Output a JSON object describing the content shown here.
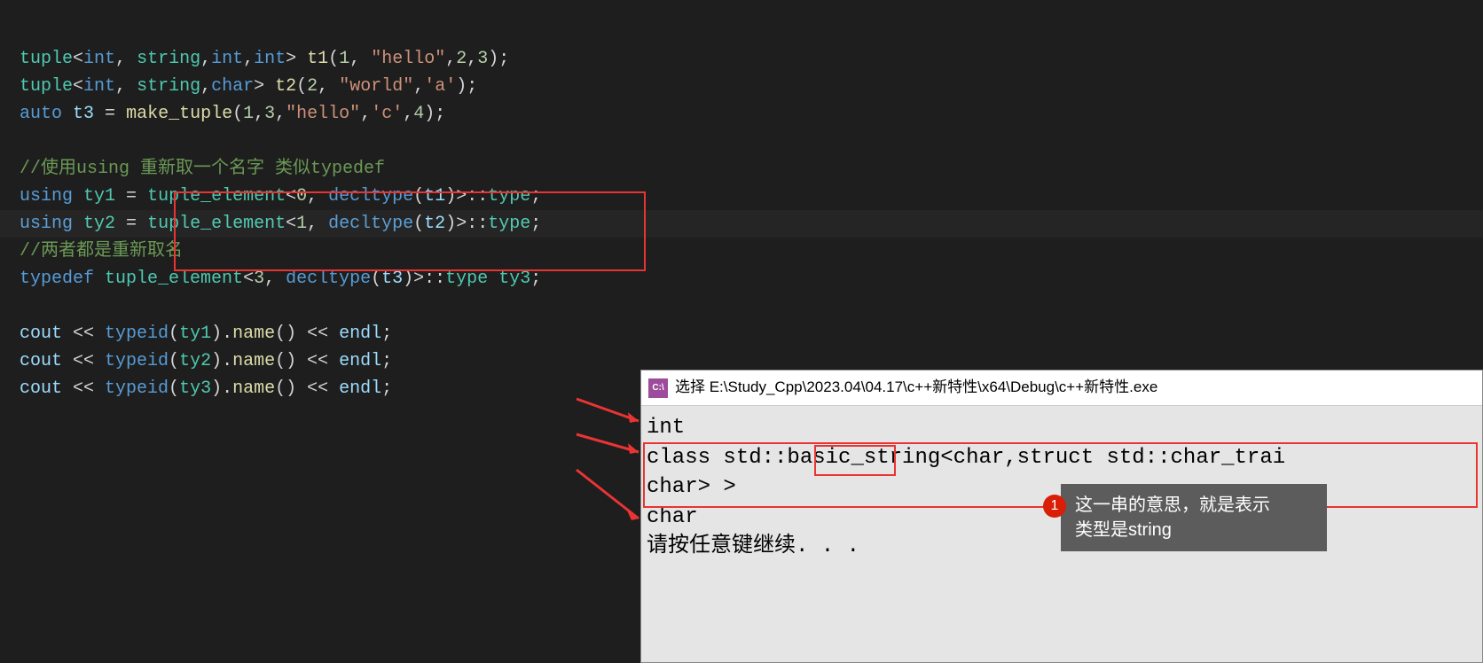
{
  "code": {
    "line1": {
      "type": "tuple",
      "angles_open": "<",
      "t_int1": "int",
      "comma1": ", ",
      "t_string": "string",
      "comma2": ",",
      "t_int2": "int",
      "comma3": ",",
      "t_int3": "int",
      "angles_close": "> ",
      "var": "t1",
      "paren_open": "(",
      "n1": "1",
      "c1": ", ",
      "s1": "\"hello\"",
      "c2": ",",
      "n2": "2",
      "c3": ",",
      "n3": "3",
      "paren_close": ");"
    },
    "line2": {
      "type": "tuple",
      "angles_open": "<",
      "t_int": "int",
      "comma1": ", ",
      "t_string": "string",
      "comma2": ",",
      "t_char": "char",
      "angles_close": "> ",
      "var": "t2",
      "paren_open": "(",
      "n1": "2",
      "c1": ", ",
      "s1": "\"world\"",
      "c2": ",",
      "ch1": "'a'",
      "paren_close": ");"
    },
    "line3": {
      "kw": "auto",
      "sp1": " ",
      "var": "t3",
      "eq": " = ",
      "func": "make_tuple",
      "paren_open": "(",
      "n1": "1",
      "c1": ",",
      "n2": "3",
      "c2": ",",
      "s1": "\"hello\"",
      "c3": ",",
      "ch1": "'c'",
      "c4": ",",
      "n3": "4",
      "paren_close": ");"
    },
    "comment1": "//使用using 重新取一个名字 类似typedef",
    "line5": {
      "kw": "using",
      "sp1": " ",
      "ty": "ty1",
      "eq": " = ",
      "te": "tuple_element",
      "ao": "<",
      "n": "0",
      "c": ", ",
      "dt": "decltype",
      "po": "(",
      "v": "t1",
      "pc": ")>::",
      "type": "type",
      "semi": ";"
    },
    "line6": {
      "kw": "using",
      "sp1": " ",
      "ty": "ty2",
      "eq": " = ",
      "te": "tuple_element",
      "ao": "<",
      "n": "1",
      "c": ", ",
      "dt": "decltype",
      "po": "(",
      "v": "t2",
      "pc": ")>::",
      "type": "type",
      "semi": ";"
    },
    "comment2": "//两者都是重新取名",
    "line8": {
      "kw": "typedef",
      "sp1": " ",
      "te": "tuple_element",
      "ao": "<",
      "n": "3",
      "c": ", ",
      "dt": "decltype",
      "po": "(",
      "v": "t3",
      "pc": ")>::",
      "type": "type",
      "sp2": " ",
      "ty": "ty3",
      "semi": ";"
    },
    "cout_lines": [
      {
        "cout": "cout",
        "sp": " << ",
        "tid": "typeid",
        "po": "(",
        "ty": "ty1",
        "pc": ").",
        "nm": "name",
        "call": "() << ",
        "endl": "endl",
        "semi": ";"
      },
      {
        "cout": "cout",
        "sp": " << ",
        "tid": "typeid",
        "po": "(",
        "ty": "ty2",
        "pc": ").",
        "nm": "name",
        "call": "() << ",
        "endl": "endl",
        "semi": ";"
      },
      {
        "cout": "cout",
        "sp": " << ",
        "tid": "typeid",
        "po": "(",
        "ty": "ty3",
        "pc": ").",
        "nm": "name",
        "call": "() << ",
        "endl": "endl",
        "semi": ";"
      }
    ]
  },
  "console": {
    "icon_text": "C:\\",
    "title": "选择 E:\\Study_Cpp\\2023.04\\04.17\\c++新特性\\x64\\Debug\\c++新特性.exe",
    "out1": "int",
    "out2a": "class std::basic_",
    "out2b": "string<",
    "out2c": "char,struct std::char_trai",
    "out3": "char> >",
    "out4": "char",
    "out5": "请按任意键继续. . ."
  },
  "annotation": {
    "num": "1",
    "text1": "这一串的意思，就是表示",
    "text2": "类型是string"
  }
}
